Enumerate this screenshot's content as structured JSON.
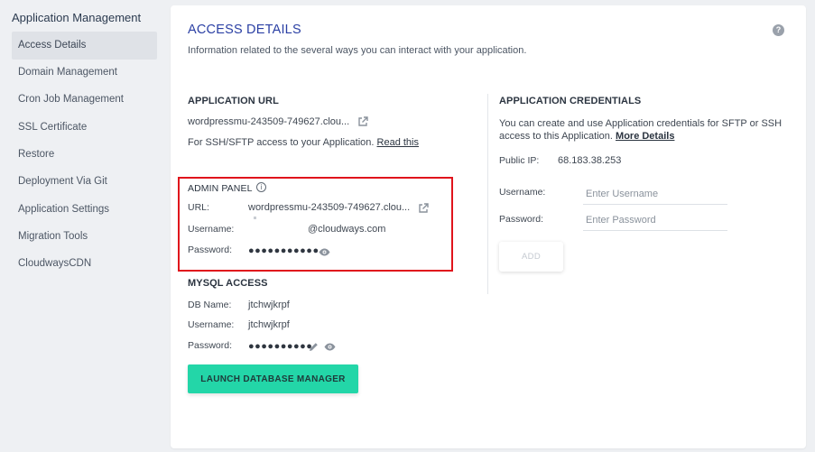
{
  "sidebar": {
    "title": "Application Management",
    "items": [
      {
        "label": "Access Details",
        "active": true
      },
      {
        "label": "Domain Management"
      },
      {
        "label": "Cron Job Management"
      },
      {
        "label": "SSL Certificate"
      },
      {
        "label": "Restore"
      },
      {
        "label": "Deployment Via Git"
      },
      {
        "label": "Application Settings"
      },
      {
        "label": "Migration Tools"
      },
      {
        "label": "CloudwaysCDN"
      }
    ]
  },
  "main": {
    "title": "ACCESS DETAILS",
    "subtitle": "Information related to the several ways you can interact with your application.",
    "help_icon": "?",
    "app_url": {
      "heading": "APPLICATION URL",
      "url": "wordpressmu-243509-749627.clou...",
      "ssh_note": "For SSH/SFTP access to your Application.",
      "read_this": "Read this"
    },
    "admin_panel": {
      "heading": "ADMIN PANEL",
      "url_label": "URL:",
      "url_value": "wordpressmu-243509-749627.clou...",
      "username_label": "Username:",
      "username_value": "@cloudways.com",
      "password_label": "Password:",
      "password_value": "●●●●●●●●●●●"
    },
    "mysql": {
      "heading": "MYSQL ACCESS",
      "db_label": "DB Name:",
      "db_value": "jtchwjkrpf",
      "username_label": "Username:",
      "username_value": "jtchwjkrpf",
      "password_label": "Password:",
      "password_value": "●●●●●●●●●●"
    },
    "launch_button": "LAUNCH DATABASE MANAGER",
    "credentials": {
      "heading": "APPLICATION CREDENTIALS",
      "desc": "You can create and use Application credentials for SFTP or SSH access to this Application.",
      "more_details": "More Details",
      "public_ip_label": "Public IP:",
      "public_ip_value": "68.183.38.253",
      "username_label": "Username:",
      "username_placeholder": "Enter Username",
      "password_label": "Password:",
      "password_placeholder": "Enter Password",
      "add_button": "ADD"
    }
  },
  "colors": {
    "accent_title": "#2b40a4",
    "launch_button": "#23d6a8",
    "highlight_box": "#e0141c",
    "background": "#eef0f3"
  },
  "icons": {
    "external_link": "external-link-icon",
    "eye": "eye-icon",
    "pencil": "pencil-icon",
    "info": "info-icon",
    "help": "help-icon"
  }
}
